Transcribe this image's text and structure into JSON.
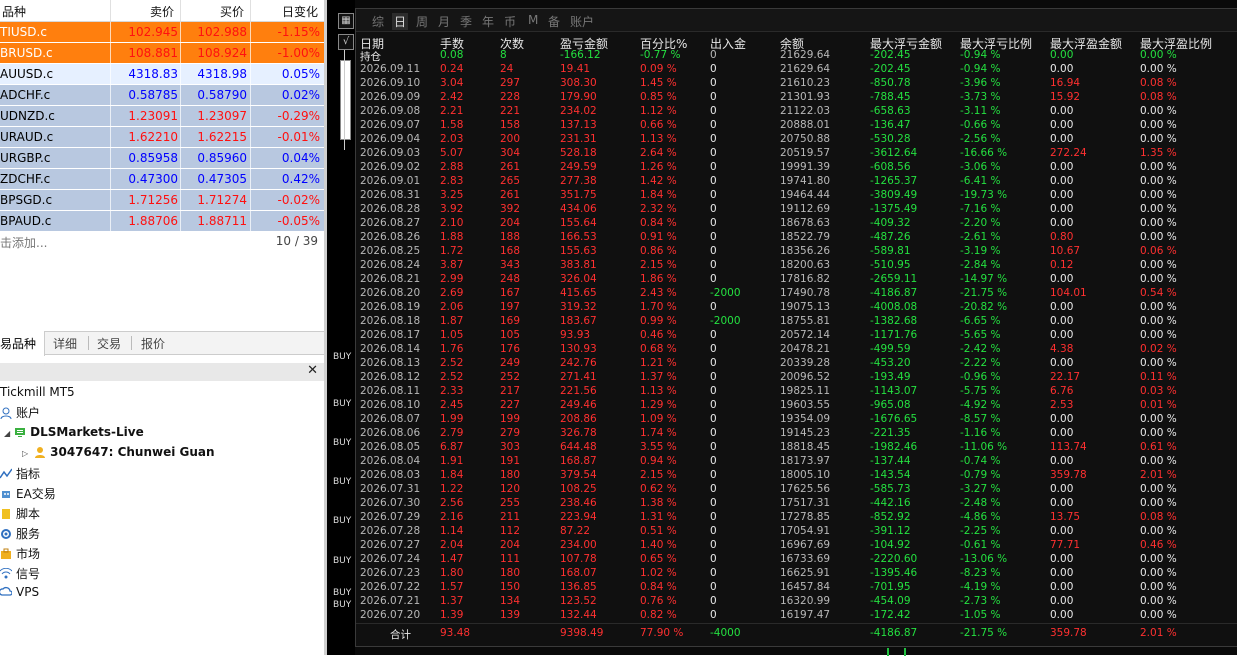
{
  "market_watch": {
    "headers": {
      "symbol": "品种",
      "bid": "卖价",
      "ask": "买价",
      "change": "日变化"
    },
    "rows": [
      {
        "symbol": "TIUSD.c",
        "bid": "102.945",
        "ask": "102.988",
        "change": "-1.15%",
        "bg": "#ff7f0e",
        "fg": "#ffffff",
        "valfg": "#ff1010"
      },
      {
        "symbol": "BRUSD.c",
        "bid": "108.881",
        "ask": "108.924",
        "change": "-1.00%",
        "bg": "#ff7f0e",
        "fg": "#ffffff",
        "valfg": "#ff1010"
      },
      {
        "symbol": "AUUSD.c",
        "bid": "4318.83",
        "ask": "4318.98",
        "change": "0.05%",
        "bg": "#e6f0ff",
        "fg": "#000000",
        "valfg": "#0000ff"
      },
      {
        "symbol": "ADCHF.c",
        "bid": "0.58785",
        "ask": "0.58790",
        "change": "0.02%",
        "bg": "#b8c8e0",
        "fg": "#000000",
        "valfg": "#0000ff"
      },
      {
        "symbol": "UDNZD.c",
        "bid": "1.23091",
        "ask": "1.23097",
        "change": "-0.29%",
        "bg": "#b8c8e0",
        "fg": "#000000",
        "valfg": "#ff1010"
      },
      {
        "symbol": "URAUD.c",
        "bid": "1.62210",
        "ask": "1.62215",
        "change": "-0.01%",
        "bg": "#b8c8e0",
        "fg": "#000000",
        "valfg": "#ff1010"
      },
      {
        "symbol": "URGBP.c",
        "bid": "0.85958",
        "ask": "0.85960",
        "change": "0.04%",
        "bg": "#b8c8e0",
        "fg": "#000000",
        "valfg": "#0000ff"
      },
      {
        "symbol": "ZDCHF.c",
        "bid": "0.47300",
        "ask": "0.47305",
        "change": "0.42%",
        "bg": "#b8c8e0",
        "fg": "#000000",
        "valfg": "#0000ff"
      },
      {
        "symbol": "BPSGD.c",
        "bid": "1.71256",
        "ask": "1.71274",
        "change": "-0.02%",
        "bg": "#b8c8e0",
        "fg": "#000000",
        "valfg": "#ff1010"
      },
      {
        "symbol": "BPAUD.c",
        "bid": "1.88706",
        "ask": "1.88711",
        "change": "-0.05%",
        "bg": "#b8c8e0",
        "fg": "#000000",
        "valfg": "#ff1010"
      }
    ],
    "add_label": "击添加...",
    "count": "10 / 39",
    "tabs": [
      "易品种",
      "详细",
      "交易",
      "报价"
    ]
  },
  "navigator": {
    "title": "Tickmill MT5",
    "items": [
      {
        "label": "账户",
        "icon": "account-icon"
      },
      {
        "label": "DLSMarkets-Live",
        "icon": "server-icon"
      },
      {
        "label": "3047647: Chunwei Guan",
        "icon": "user-icon"
      },
      {
        "label": "指标",
        "icon": "indicator-icon"
      },
      {
        "label": "EA交易",
        "icon": "expert-icon"
      },
      {
        "label": "脚本",
        "icon": "script-icon"
      },
      {
        "label": "服务",
        "icon": "service-icon"
      },
      {
        "label": "市场",
        "icon": "market-icon"
      },
      {
        "label": "信号",
        "icon": "signal-icon"
      },
      {
        "label": "VPS",
        "icon": "vps-icon"
      }
    ]
  },
  "chart_strip": {
    "buy_labels": [
      "BUY",
      "BUY",
      "BUY",
      "BUY",
      "BUY",
      "BUY",
      "BUY",
      "BUY"
    ]
  },
  "stats_panel": {
    "tabs": [
      "综",
      "日",
      "周",
      "月",
      "季",
      "年",
      "币",
      "M",
      "备",
      "账户"
    ],
    "active_tab": "日",
    "headers": [
      "日期",
      "手数",
      "次数",
      "盈亏金额",
      "百分比%",
      "出入金",
      "余额",
      "最大浮亏金额",
      "最大浮亏比例",
      "最大浮盈金额",
      "最大浮盈比例"
    ],
    "position_row": [
      "持仓",
      "0.08",
      "8",
      "-166.12",
      "-0.77 %",
      "0",
      "21629.64",
      "-202.45",
      "-0.94 %",
      "0.00",
      "0.00 %"
    ],
    "rows": [
      [
        "2026.09.11",
        "0.24",
        "24",
        "19.41",
        "0.09 %",
        "0",
        "21629.64",
        "-202.45",
        "-0.94 %",
        "0.00",
        "0.00 %"
      ],
      [
        "2026.09.10",
        "3.04",
        "297",
        "308.30",
        "1.45 %",
        "0",
        "21610.23",
        "-850.78",
        "-3.96 %",
        "16.94",
        "0.08 %"
      ],
      [
        "2026.09.09",
        "2.42",
        "228",
        "179.90",
        "0.85 %",
        "0",
        "21301.93",
        "-788.45",
        "-3.73 %",
        "15.92",
        "0.08 %"
      ],
      [
        "2026.09.08",
        "2.21",
        "221",
        "234.02",
        "1.12 %",
        "0",
        "21122.03",
        "-658.63",
        "-3.11 %",
        "0.00",
        "0.00 %"
      ],
      [
        "2026.09.07",
        "1.58",
        "158",
        "137.13",
        "0.66 %",
        "0",
        "20888.01",
        "-136.47",
        "-0.66 %",
        "0.00",
        "0.00 %"
      ],
      [
        "2026.09.04",
        "2.03",
        "200",
        "231.31",
        "1.13 %",
        "0",
        "20750.88",
        "-530.28",
        "-2.56 %",
        "0.00",
        "0.00 %"
      ],
      [
        "2026.09.03",
        "5.07",
        "304",
        "528.18",
        "2.64 %",
        "0",
        "20519.57",
        "-3612.64",
        "-16.66 %",
        "272.24",
        "1.35 %"
      ],
      [
        "2026.09.02",
        "2.88",
        "261",
        "249.59",
        "1.26 %",
        "0",
        "19991.39",
        "-608.56",
        "-3.06 %",
        "0.00",
        "0.00 %"
      ],
      [
        "2026.09.01",
        "2.83",
        "265",
        "277.38",
        "1.42 %",
        "0",
        "19741.80",
        "-1265.37",
        "-6.41 %",
        "0.00",
        "0.00 %"
      ],
      [
        "2026.08.31",
        "3.25",
        "261",
        "351.75",
        "1.84 %",
        "0",
        "19464.44",
        "-3809.49",
        "-19.73 %",
        "0.00",
        "0.00 %"
      ],
      [
        "2026.08.28",
        "3.92",
        "392",
        "434.06",
        "2.32 %",
        "0",
        "19112.69",
        "-1375.49",
        "-7.16 %",
        "0.00",
        "0.00 %"
      ],
      [
        "2026.08.27",
        "2.10",
        "204",
        "155.64",
        "0.84 %",
        "0",
        "18678.63",
        "-409.32",
        "-2.20 %",
        "0.00",
        "0.00 %"
      ],
      [
        "2026.08.26",
        "1.88",
        "188",
        "166.53",
        "0.91 %",
        "0",
        "18522.79",
        "-487.26",
        "-2.61 %",
        "0.80",
        "0.00 %"
      ],
      [
        "2026.08.25",
        "1.72",
        "168",
        "155.63",
        "0.86 %",
        "0",
        "18356.26",
        "-589.81",
        "-3.19 %",
        "10.67",
        "0.06 %"
      ],
      [
        "2026.08.24",
        "3.87",
        "343",
        "383.81",
        "2.15 %",
        "0",
        "18200.63",
        "-510.95",
        "-2.84 %",
        "0.12",
        "0.00 %"
      ],
      [
        "2026.08.21",
        "2.99",
        "248",
        "326.04",
        "1.86 %",
        "0",
        "17816.82",
        "-2659.11",
        "-14.97 %",
        "0.00",
        "0.00 %"
      ],
      [
        "2026.08.20",
        "2.69",
        "167",
        "415.65",
        "2.43 %",
        "-2000",
        "17490.78",
        "-4186.87",
        "-21.75 %",
        "104.01",
        "0.54 %"
      ],
      [
        "2026.08.19",
        "2.06",
        "197",
        "319.32",
        "1.70 %",
        "0",
        "19075.13",
        "-4008.08",
        "-20.82 %",
        "0.00",
        "0.00 %"
      ],
      [
        "2026.08.18",
        "1.87",
        "169",
        "183.67",
        "0.99 %",
        "-2000",
        "18755.81",
        "-1382.68",
        "-6.65 %",
        "0.00",
        "0.00 %"
      ],
      [
        "2026.08.17",
        "1.05",
        "105",
        "93.93",
        "0.46 %",
        "0",
        "20572.14",
        "-1171.76",
        "-5.65 %",
        "0.00",
        "0.00 %"
      ],
      [
        "2026.08.14",
        "1.76",
        "176",
        "130.93",
        "0.68 %",
        "0",
        "20478.21",
        "-499.59",
        "-2.42 %",
        "4.38",
        "0.02 %"
      ],
      [
        "2026.08.13",
        "2.52",
        "249",
        "242.76",
        "1.21 %",
        "0",
        "20339.28",
        "-453.20",
        "-2.22 %",
        "0.00",
        "0.00 %"
      ],
      [
        "2026.08.12",
        "2.52",
        "252",
        "271.41",
        "1.37 %",
        "0",
        "20096.52",
        "-193.49",
        "-0.96 %",
        "22.17",
        "0.11 %"
      ],
      [
        "2026.08.11",
        "2.33",
        "217",
        "221.56",
        "1.13 %",
        "0",
        "19825.11",
        "-1143.07",
        "-5.75 %",
        "6.76",
        "0.03 %"
      ],
      [
        "2026.08.10",
        "2.45",
        "227",
        "249.46",
        "1.29 %",
        "0",
        "19603.55",
        "-965.08",
        "-4.92 %",
        "2.53",
        "0.01 %"
      ],
      [
        "2026.08.07",
        "1.99",
        "199",
        "208.86",
        "1.09 %",
        "0",
        "19354.09",
        "-1676.65",
        "-8.57 %",
        "0.00",
        "0.00 %"
      ],
      [
        "2026.08.06",
        "2.79",
        "279",
        "326.78",
        "1.74 %",
        "0",
        "19145.23",
        "-221.35",
        "-1.16 %",
        "0.00",
        "0.00 %"
      ],
      [
        "2026.08.05",
        "6.87",
        "303",
        "644.48",
        "3.55 %",
        "0",
        "18818.45",
        "-1982.46",
        "-11.06 %",
        "113.74",
        "0.61 %"
      ],
      [
        "2026.08.04",
        "1.91",
        "191",
        "168.87",
        "0.94 %",
        "0",
        "18173.97",
        "-137.44",
        "-0.74 %",
        "0.00",
        "0.00 %"
      ],
      [
        "2026.08.03",
        "1.84",
        "180",
        "379.54",
        "2.15 %",
        "0",
        "18005.10",
        "-143.54",
        "-0.79 %",
        "359.78",
        "2.01 %"
      ],
      [
        "2026.07.31",
        "1.22",
        "120",
        "108.25",
        "0.62 %",
        "0",
        "17625.56",
        "-585.73",
        "-3.27 %",
        "0.00",
        "0.00 %"
      ],
      [
        "2026.07.30",
        "2.56",
        "255",
        "238.46",
        "1.38 %",
        "0",
        "17517.31",
        "-442.16",
        "-2.48 %",
        "0.00",
        "0.00 %"
      ],
      [
        "2026.07.29",
        "2.16",
        "211",
        "223.94",
        "1.31 %",
        "0",
        "17278.85",
        "-852.92",
        "-4.86 %",
        "13.75",
        "0.08 %"
      ],
      [
        "2026.07.28",
        "1.14",
        "112",
        "87.22",
        "0.51 %",
        "0",
        "17054.91",
        "-391.12",
        "-2.25 %",
        "0.00",
        "0.00 %"
      ],
      [
        "2026.07.27",
        "2.04",
        "204",
        "234.00",
        "1.40 %",
        "0",
        "16967.69",
        "-104.92",
        "-0.61 %",
        "77.71",
        "0.46 %"
      ],
      [
        "2026.07.24",
        "1.47",
        "111",
        "107.78",
        "0.65 %",
        "0",
        "16733.69",
        "-2220.60",
        "-13.06 %",
        "0.00",
        "0.00 %"
      ],
      [
        "2026.07.23",
        "1.80",
        "180",
        "168.07",
        "1.02 %",
        "0",
        "16625.91",
        "-1395.46",
        "-8.23 %",
        "0.00",
        "0.00 %"
      ],
      [
        "2026.07.22",
        "1.57",
        "150",
        "136.85",
        "0.84 %",
        "0",
        "16457.84",
        "-701.95",
        "-4.19 %",
        "0.00",
        "0.00 %"
      ],
      [
        "2026.07.21",
        "1.37",
        "134",
        "123.52",
        "0.76 %",
        "0",
        "16320.99",
        "-454.09",
        "-2.73 %",
        "0.00",
        "0.00 %"
      ],
      [
        "2026.07.20",
        "1.39",
        "139",
        "132.44",
        "0.82 %",
        "0",
        "16197.47",
        "-172.42",
        "-1.05 %",
        "0.00",
        "0.00 %"
      ]
    ],
    "total_row": [
      "合计",
      "93.48",
      "",
      "9398.49",
      "77.90 %",
      "-4000",
      "",
      "-4186.87",
      "-21.75 %",
      "359.78",
      "2.01 %"
    ]
  }
}
